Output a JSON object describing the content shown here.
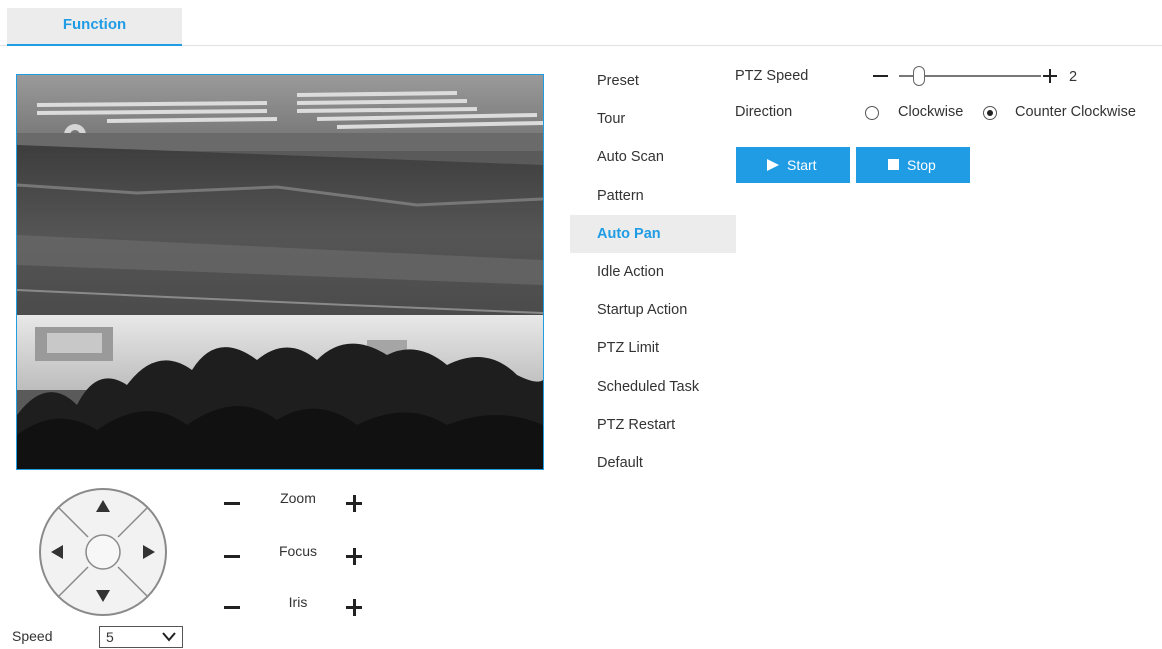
{
  "tabs": [
    {
      "label": "Function",
      "active": true
    }
  ],
  "menu": {
    "items": [
      "Preset",
      "Tour",
      "Auto Scan",
      "Pattern",
      "Auto Pan",
      "Idle Action",
      "Startup Action",
      "PTZ Limit",
      "Scheduled Task",
      "PTZ Restart",
      "Default"
    ],
    "active_index": 4
  },
  "ptz_speed": {
    "label": "PTZ Speed",
    "value": "2",
    "level_fraction": 0.14
  },
  "direction": {
    "label": "Direction",
    "options": [
      {
        "label": "Clockwise",
        "checked": false
      },
      {
        "label": "Counter Clockwise",
        "checked": true
      }
    ]
  },
  "buttons": {
    "start": "Start",
    "stop": "Stop"
  },
  "lens": {
    "zoom": "Zoom",
    "focus": "Focus",
    "iris": "Iris"
  },
  "speed": {
    "label": "Speed",
    "value": "5"
  },
  "colors": {
    "accent": "#1f9ce4",
    "active_bg": "#ececec"
  },
  "icons": [
    "arrow-up-icon",
    "arrow-down-icon",
    "arrow-left-icon",
    "arrow-right-icon",
    "play-icon",
    "stop-square-icon",
    "chevron-down-icon",
    "minus-icon",
    "plus-icon"
  ]
}
